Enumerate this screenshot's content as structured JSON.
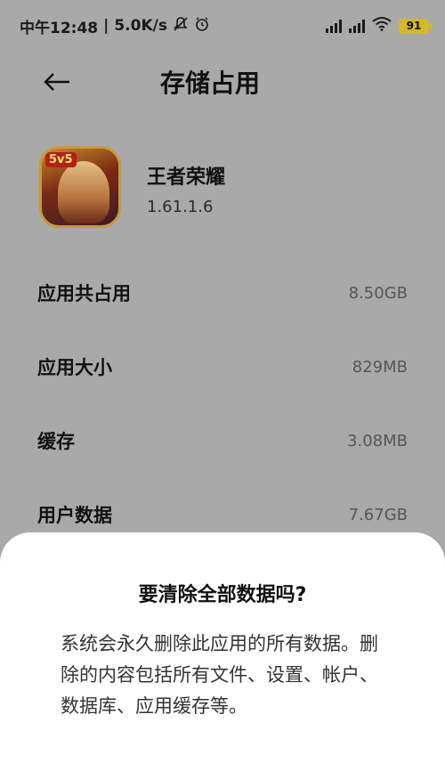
{
  "status_bar": {
    "time_text": "中午12:48",
    "network_speed": "5.0K/s",
    "battery_level": "91"
  },
  "header": {
    "back_icon": "arrow-left-icon",
    "title": "存储占用"
  },
  "app": {
    "name": "王者荣耀",
    "version": "1.61.1.6",
    "icon_badge": "5v5"
  },
  "storage": {
    "rows": [
      {
        "label": "应用共占用",
        "value": "8.50GB"
      },
      {
        "label": "应用大小",
        "value": "829MB"
      },
      {
        "label": "缓存",
        "value": "3.08MB"
      },
      {
        "label": "用户数据",
        "value": "7.67GB"
      }
    ]
  },
  "dialog": {
    "title": "要清除全部数据吗?",
    "message": "系统会永久删除此应用的所有数据。删除的内容包括所有文件、设置、帐户、数据库、应用缓存等。"
  },
  "colors": {
    "dim_overlay": "#a9a9a9",
    "sheet_bg": "#ffffff",
    "battery": "#d2b82a"
  }
}
